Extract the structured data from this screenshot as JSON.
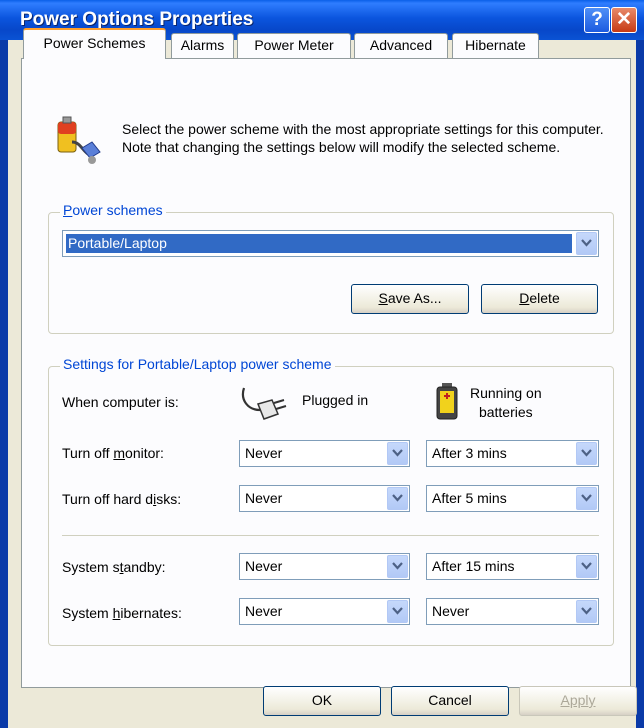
{
  "window": {
    "title": "Power Options Properties",
    "help_label": "?",
    "close_label": "✕"
  },
  "tabs": [
    {
      "label": "Power Schemes",
      "active": true
    },
    {
      "label": "Alarms"
    },
    {
      "label": "Power Meter"
    },
    {
      "label": "Advanced"
    },
    {
      "label": "Hibernate"
    }
  ],
  "intro": {
    "text": "Select the power scheme with the most appropriate settings for this computer. Note that changing the settings below will modify the selected scheme."
  },
  "schemes_group": {
    "label_prefix": "P",
    "label_rest": "ower schemes",
    "selected": "Portable/Laptop",
    "save_as": {
      "mnemonic": "S",
      "rest": "ave As..."
    },
    "delete": {
      "mnemonic": "D",
      "rest": "elete"
    }
  },
  "settings_group": {
    "label": "Settings for Portable/Laptop power scheme",
    "when_label": "When computer is:",
    "plugged_in": "Plugged in",
    "batteries_line1": "Running on",
    "batteries_line2": "batteries",
    "rows": [
      {
        "pre": "Turn off ",
        "mn": "m",
        "post": "onitor:",
        "plugged": "Never",
        "battery": "After 3 mins"
      },
      {
        "pre": "Turn off hard d",
        "mn": "i",
        "post": "sks:",
        "plugged": "Never",
        "battery": "After 5 mins"
      },
      {
        "pre": "System s",
        "mn": "t",
        "post": "andby:",
        "plugged": "Never",
        "battery": "After 15 mins"
      },
      {
        "pre": "System ",
        "mn": "h",
        "post": "ibernates:",
        "plugged": "Never",
        "battery": "Never"
      }
    ]
  },
  "buttons": {
    "ok": "OK",
    "cancel": "Cancel",
    "apply": "Apply"
  },
  "colors": {
    "titlebar": "#0a53d4",
    "tab_highlight": "#ff9e2c",
    "selection": "#316ac5",
    "group_label": "#0046d5"
  }
}
